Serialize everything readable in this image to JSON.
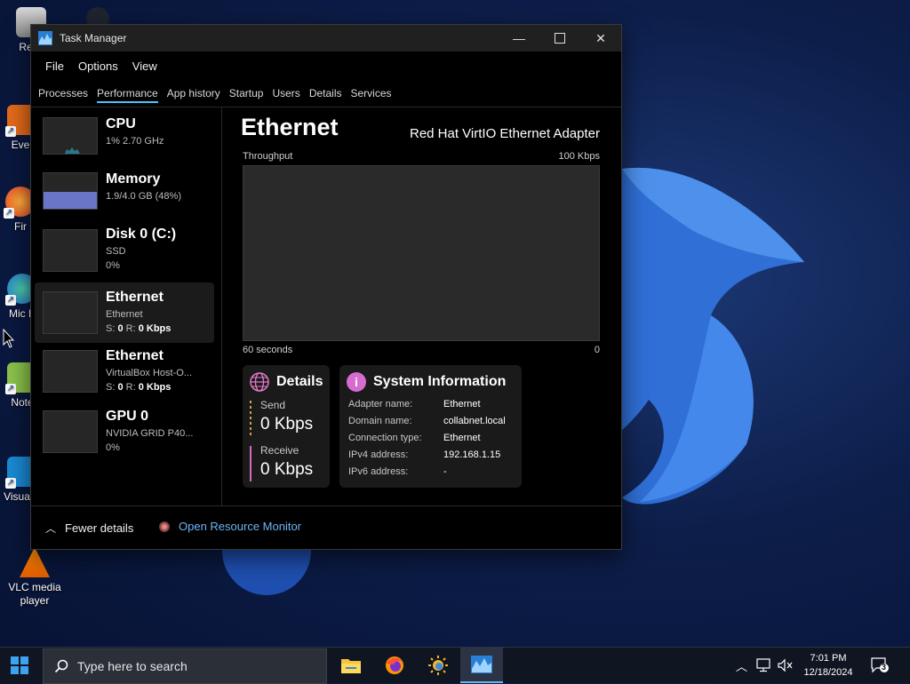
{
  "desktop": {
    "icons": [
      {
        "label": "Recy"
      },
      {
        "label": "Ever"
      },
      {
        "label": "Fir"
      },
      {
        "label": "Mic E"
      },
      {
        "label": "Note"
      },
      {
        "label": "Visua C"
      },
      {
        "label": "VLC media player"
      }
    ]
  },
  "window": {
    "title": "Task Manager",
    "menu": [
      "File",
      "Options",
      "View"
    ],
    "tabs": [
      "Processes",
      "Performance",
      "App history",
      "Startup",
      "Users",
      "Details",
      "Services"
    ],
    "active_tab": "Performance"
  },
  "sidebar": {
    "items": [
      {
        "name": "CPU",
        "line1": "1% 2.70 GHz",
        "line2": ""
      },
      {
        "name": "Memory",
        "line1": "1.9/4.0 GB (48%)",
        "line2": ""
      },
      {
        "name": "Disk 0 (C:)",
        "line1": "SSD",
        "line2": "0%"
      },
      {
        "name": "Ethernet",
        "line1": "Ethernet",
        "s_label": "S:",
        "s_val": "0",
        "r_label": "R:",
        "r_val": "0 Kbps"
      },
      {
        "name": "Ethernet",
        "line1": "VirtualBox Host-O...",
        "s_label": "S:",
        "s_val": "0",
        "r_label": "R:",
        "r_val": "0 Kbps"
      },
      {
        "name": "GPU 0",
        "line1": "NVIDIA GRID P40...",
        "line2": "0%"
      }
    ],
    "selected_index": 3
  },
  "main": {
    "title": "Ethernet",
    "adapter": "Red Hat VirtIO Ethernet Adapter",
    "graph": {
      "label_top_left": "Throughput",
      "label_top_right": "100 Kbps",
      "label_bottom_left": "60 seconds",
      "label_bottom_right": "0"
    },
    "details": {
      "title": "Details",
      "send_label": "Send",
      "send_value": "0 Kbps",
      "receive_label": "Receive",
      "receive_value": "0 Kbps"
    },
    "system_info": {
      "title": "System Information",
      "rows": [
        {
          "label": "Adapter name:",
          "value": "Ethernet"
        },
        {
          "label": "Domain name:",
          "value": "collabnet.local"
        },
        {
          "label": "Connection type:",
          "value": "Ethernet"
        },
        {
          "label": "IPv4 address:",
          "value": "192.168.1.15"
        },
        {
          "label": "IPv6 address:",
          "value": "-"
        }
      ]
    }
  },
  "footer": {
    "fewer_details": "Fewer details",
    "open_resource_monitor": "Open Resource Monitor"
  },
  "taskbar": {
    "search_placeholder": "Type here to search",
    "time": "7:01 PM",
    "date": "12/18/2024",
    "notification_count": "3"
  },
  "colors": {
    "accent": "#4cc2ff",
    "memory_fill": "#6b75c8",
    "cpu_line": "#35b0c8",
    "send_bar": "#c9a24a",
    "receive_bar": "#d36ab7",
    "link": "#6db5f5"
  }
}
